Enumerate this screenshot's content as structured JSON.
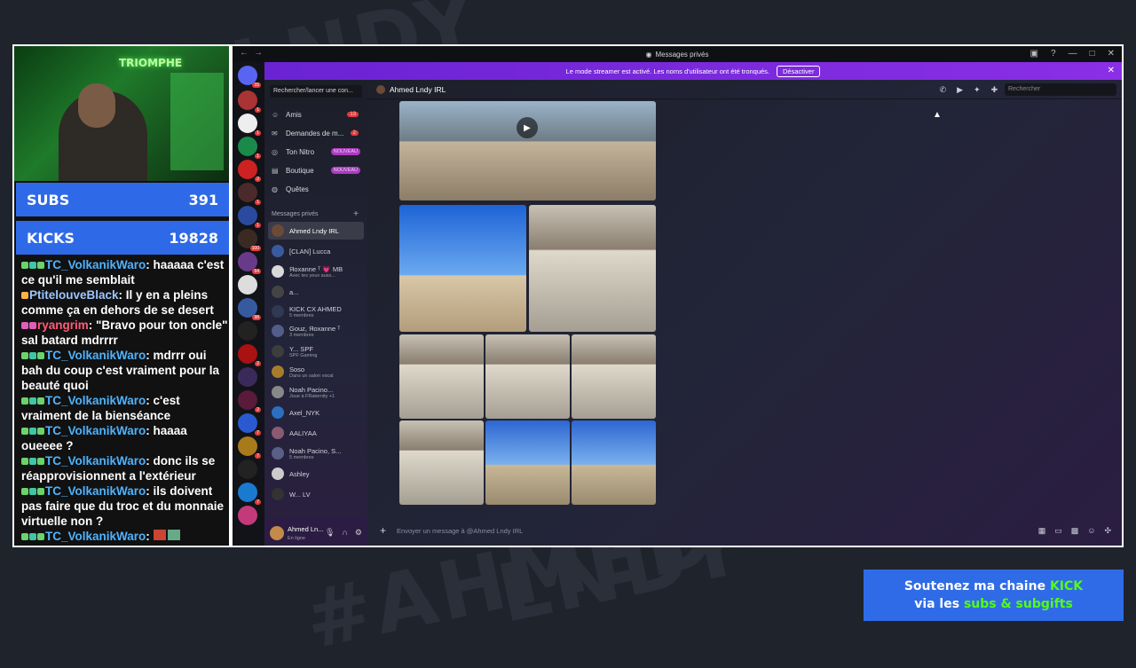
{
  "background_text": [
    "LNDY",
    "#AHMED",
    "LNDY"
  ],
  "stream": {
    "webcam_sign": "TRIOMPHE",
    "subs_label": "SUBS",
    "subs_value": "391",
    "kicks_label": "KICKS",
    "kicks_value": "19828",
    "chat": [
      {
        "user": "TC_VolkanikWaro",
        "text": ": haaaaa c'est ce qu'il me semblait"
      },
      {
        "user": "PtitelouveBlack",
        "text": ": Il y en a pleins comme ça en dehors de se desert"
      },
      {
        "user": "ryangrim",
        "text": ": \"Bravo pour ton oncle\" sal batard mdrrrr"
      },
      {
        "user": "TC_VolkanikWaro",
        "text": ": mdrrr oui bah du coup c'est vraiment pour la beauté quoi"
      },
      {
        "user": "TC_VolkanikWaro",
        "text": ": c'est vraiment de la bienséance"
      },
      {
        "user": "TC_VolkanikWaro",
        "text": ": haaaa oueeee ?"
      },
      {
        "user": "TC_VolkanikWaro",
        "text": ": donc ils se réapprovisionnent a l'extérieur"
      },
      {
        "user": "TC_VolkanikWaro",
        "text": ": ils doivent pas faire que du troc et du monnaie virtuelle non ?"
      },
      {
        "user": "TC_VolkanikWaro",
        "text": ":"
      }
    ]
  },
  "discord": {
    "window_title": "Messages privés",
    "banner_text": "Le mode streamer est activé. Les noms d'utilisateur ont été tronqués.",
    "banner_button": "Désactiver",
    "search_placeholder": "Rechercher/lancer une con...",
    "nav": [
      {
        "icon": "person-icon",
        "label": "Amis",
        "count": "13"
      },
      {
        "icon": "mail-icon",
        "label": "Demandes de m...",
        "count": "2"
      },
      {
        "icon": "nitro-icon",
        "label": "Ton Nitro",
        "badge": "NOUVEAU"
      },
      {
        "icon": "shop-icon",
        "label": "Boutique",
        "badge": "NOUVEAU"
      },
      {
        "icon": "quest-icon",
        "label": "Quêtes"
      }
    ],
    "dm_section": "Messages privés",
    "dms": [
      {
        "name": "Ahmed Lndy IRL",
        "sub": "",
        "color": "#6b4a36"
      },
      {
        "name": "[CLAN] Lucca",
        "sub": "",
        "color": "#3a5aa0"
      },
      {
        "name": "Яoxanne ᵀ 💗 MB",
        "sub": "Avec tes yeux auss...",
        "color": "#d9d9d9"
      },
      {
        "name": "a...",
        "sub": "",
        "color": "#444"
      },
      {
        "name": "KICK CX AHMED",
        "sub": "5 membres",
        "color": "#2f3a52"
      },
      {
        "name": "Gouz, Яoxanne ᵀ",
        "sub": "3 membres",
        "color": "#525d8a"
      },
      {
        "name": "Y... SPF",
        "sub": "SPF Gaming",
        "color": "#3d3d3d"
      },
      {
        "name": "Soso",
        "sub": "Dans un salon vocal",
        "color": "#a57d2a"
      },
      {
        "name": "Noah Pacino...",
        "sub": "Joue à FRaternity +1",
        "color": "#888"
      },
      {
        "name": "Axel_NYK",
        "sub": "",
        "color": "#2a6fc2"
      },
      {
        "name": "AALIYAA",
        "sub": "",
        "color": "#8a5b70"
      },
      {
        "name": "Noah Pacino, S...",
        "sub": "5 membres",
        "color": "#5a5f88"
      },
      {
        "name": "Ashley",
        "sub": "",
        "color": "#ccc"
      },
      {
        "name": "W... LV",
        "sub": "",
        "color": "#333"
      }
    ],
    "user": {
      "name": "Ahmed Ln...",
      "status": "En ligne"
    },
    "channel_name": "Ahmed Lndy IRL",
    "header_search": "Rechercher",
    "composer_placeholder": "Envoyer un message à @Ahmed Lndy IRL"
  },
  "promo": {
    "line1_a": "Soutenez ma chaine ",
    "line1_b": "KICK",
    "line2_a": "via les ",
    "line2_b": "subs & subgifts"
  }
}
